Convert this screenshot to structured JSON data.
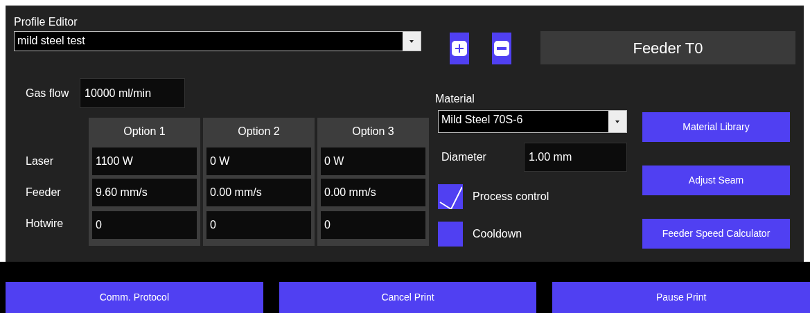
{
  "title": "Profile Editor",
  "profile": {
    "value": "mild steel test"
  },
  "profile_buttons": [
    {
      "kind": "add"
    },
    {
      "kind": "remove"
    }
  ],
  "feeder_label": "Feeder T0",
  "gas_flow": {
    "label": "Gas flow",
    "value": "10000 ml/min"
  },
  "table": {
    "columns": [
      "Option 1",
      "Option 2",
      "Option 3"
    ],
    "rows": [
      {
        "label": "Laser",
        "values": [
          "1100 W",
          "0 W",
          "0 W"
        ]
      },
      {
        "label": "Feeder",
        "values": [
          "9.60 mm/s",
          "0.00 mm/s",
          "0.00 mm/s"
        ]
      },
      {
        "label": "Hotwire",
        "values": [
          "0",
          "0",
          "0"
        ]
      }
    ]
  },
  "material": {
    "label": "Material",
    "value": "Mild Steel 70S-6"
  },
  "diameter": {
    "label": "Diameter",
    "value": "1.00 mm"
  },
  "checkboxes": [
    {
      "label": "Process control",
      "checked": true
    },
    {
      "label": "Cooldown",
      "checked": false
    }
  ],
  "side_buttons": [
    "Material Library",
    "Adjust Seam",
    "Feeder Speed Calculator"
  ],
  "bottom_buttons": [
    "Comm. Protocol",
    "Cancel Print",
    "Pause Print"
  ]
}
